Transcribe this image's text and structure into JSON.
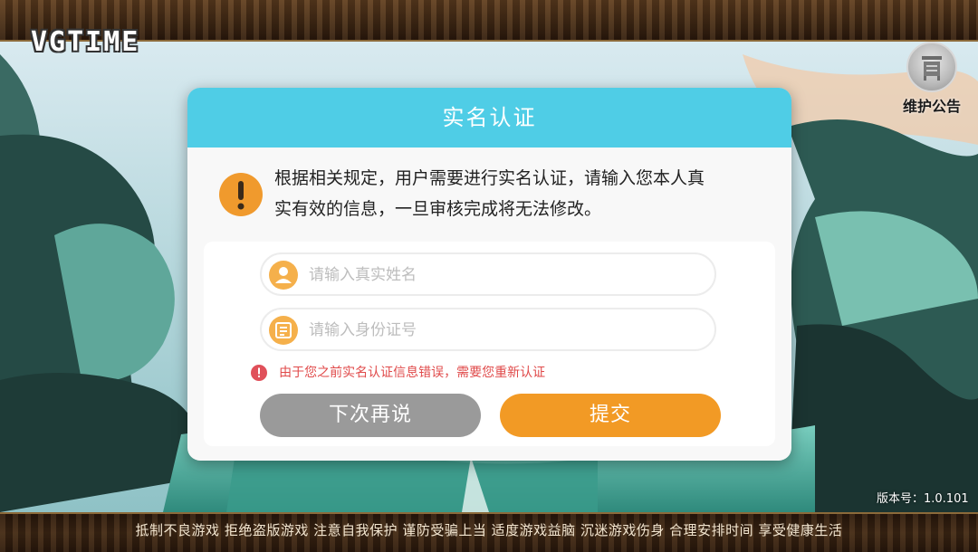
{
  "watermark": "VGTIME",
  "notice": {
    "label": "维护公告",
    "icon": "notice-board-icon"
  },
  "dialog": {
    "title": "实名认证",
    "message_line1": "根据相关规定，用户需要进行实名认证，请输入您本人真",
    "message_line2": "实有效的信息，一旦审核完成将无法修改。",
    "name_field": {
      "placeholder": "请输入真实姓名",
      "value": ""
    },
    "id_field": {
      "placeholder": "请输入身份证号",
      "value": ""
    },
    "error_text": "由于您之前实名认证信息错误，需要您重新认证",
    "later_button": "下次再说",
    "submit_button": "提交"
  },
  "version": "版本号：1.0.101",
  "footer": "抵制不良游戏 拒绝盗版游戏 注意自我保护 谨防受骗上当 适度游戏益脑 沉迷游戏伤身 合理安排时间 享受健康生活",
  "colors": {
    "header": "#4fcde6",
    "submit": "#f29a25",
    "later": "#9a9a9a",
    "warning": "#f09a2d",
    "error": "#e04a4a"
  }
}
